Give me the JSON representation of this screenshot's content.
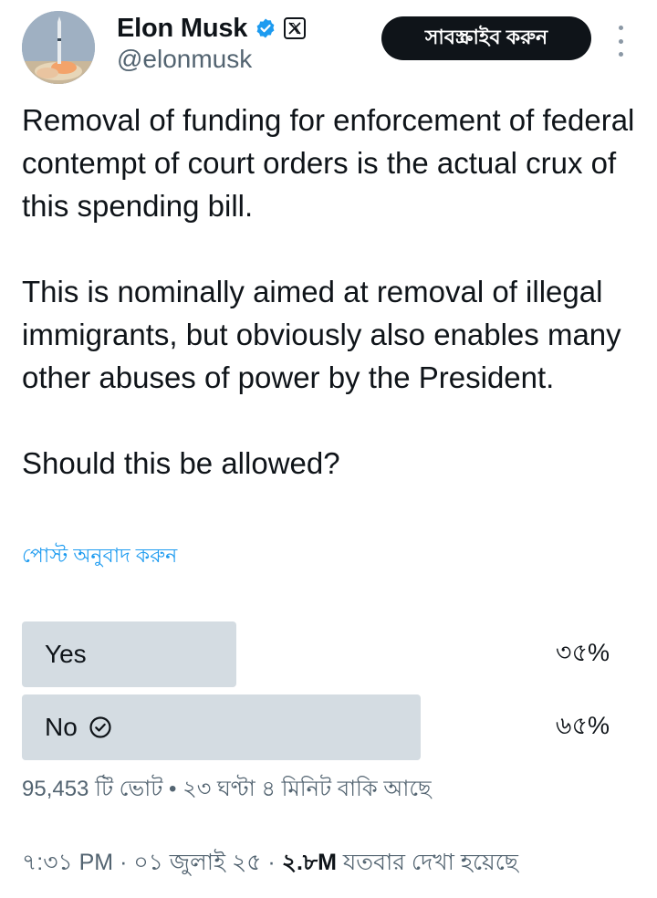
{
  "author": {
    "display_name": "Elon Musk",
    "handle": "@elonmusk"
  },
  "header": {
    "subscribe_label": "সাবস্ক্রাইব করুন"
  },
  "tweet": {
    "paragraphs": [
      "Removal of funding for enforcement of federal contempt of court orders is the actual crux of this spending bill.",
      "This is nominally aimed at removal of illegal immigrants, but obviously also enables many other abuses of power by the President.",
      "Should this be allowed?"
    ],
    "translate_label": "পোস্ট অনুবাদ করুন"
  },
  "poll": {
    "options": [
      {
        "label": "Yes",
        "percent_label": "৩৫%",
        "fraction": 0.35,
        "selected": false
      },
      {
        "label": "No",
        "percent_label": "৬৫%",
        "fraction": 0.65,
        "selected": true
      }
    ],
    "votes": "95,453 টি ভোট",
    "separator": "•",
    "time_left": "২৩ ঘণ্টা ৪ মিনিট বাকি আছে"
  },
  "footer": {
    "time": "৭:৩১ PM",
    "date": "০১ জুলাই ২৫",
    "dot": "·",
    "views_count": "২.৮M",
    "views_label": "যতবার দেখা হয়েছে"
  },
  "colors": {
    "accent": "#1d9bf0",
    "poll_bar": "#d4dce2",
    "button_bg": "#0f1419",
    "muted_text": "#536471"
  },
  "icons": {
    "verified": "verified-badge-icon",
    "x_logo": "x-logo-icon",
    "more": "more-dots-icon",
    "check": "check-circle-icon"
  }
}
